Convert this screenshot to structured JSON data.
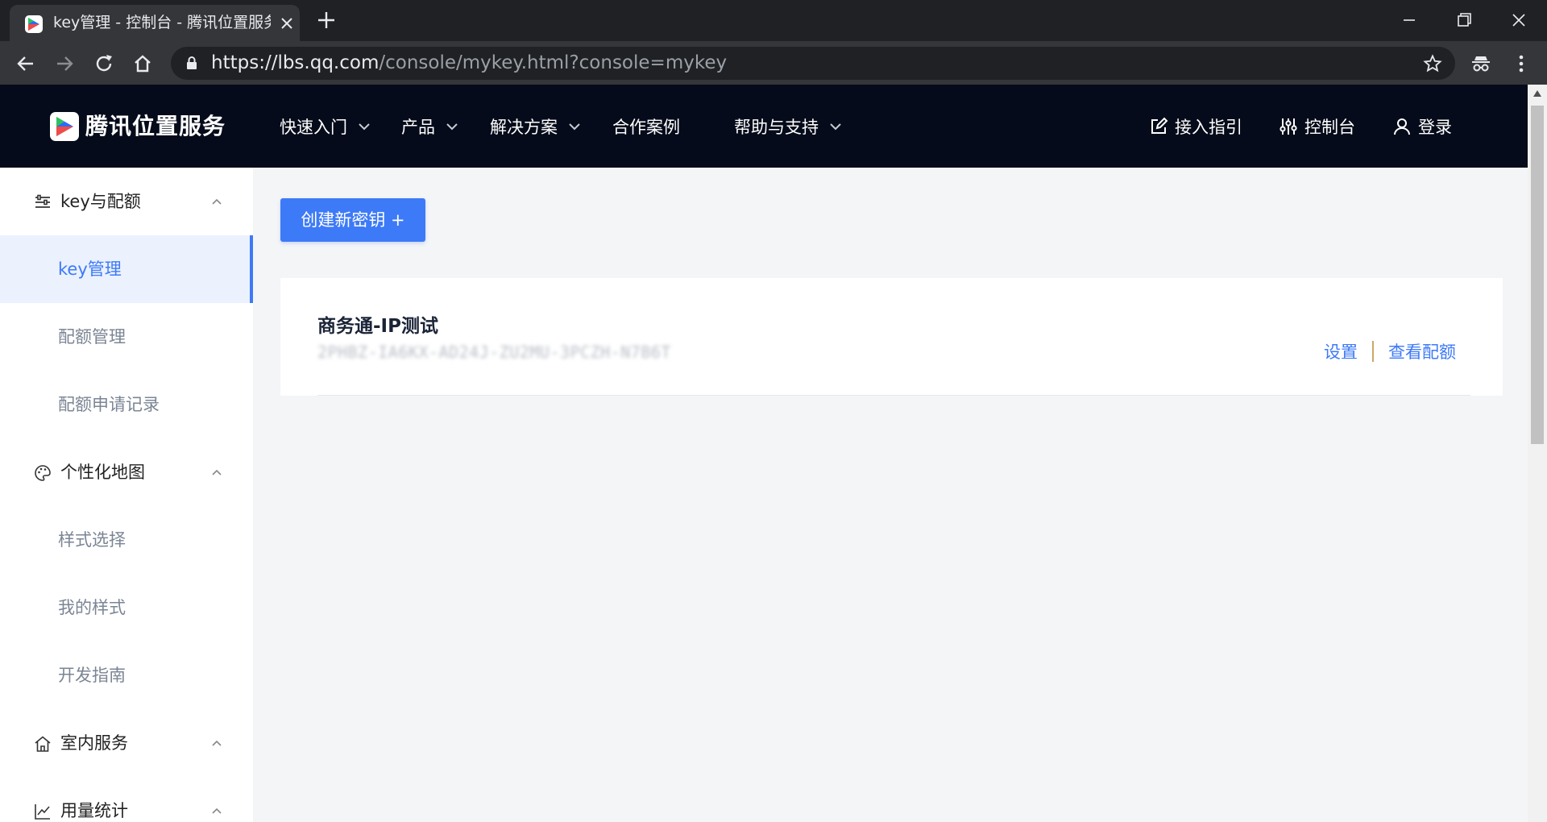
{
  "browser": {
    "tab_title": "key管理 - 控制台 - 腾讯位置服务",
    "url_host": "https://lbs.qq.com",
    "url_path": "/console/mykey.html?console=mykey"
  },
  "header": {
    "logo_text": "腾讯位置服务",
    "nav": [
      {
        "label": "快速入门"
      },
      {
        "label": "产品"
      },
      {
        "label": "解决方案"
      },
      {
        "label": "合作案例"
      },
      {
        "label": "帮助与支持"
      }
    ],
    "right": {
      "guide": "接入指引",
      "console": "控制台",
      "login": "登录"
    }
  },
  "sidebar": {
    "group_key": "key与配额",
    "item_key_manage": "key管理",
    "item_quota_manage": "配额管理",
    "item_quota_apply": "配额申请记录",
    "group_map": "个性化地图",
    "item_style_select": "样式选择",
    "item_my_style": "我的样式",
    "item_dev_guide": "开发指南",
    "group_indoor": "室内服务",
    "group_usage": "用量统计"
  },
  "main": {
    "create_button": "创建新密钥 +",
    "key_card": {
      "name": "商务通-IP测试",
      "key_value": "2PHBZ-IA6KX-AD24J-ZU2MU-3PCZH-N7B6T",
      "action_settings": "设置",
      "action_quota": "查看配额"
    }
  },
  "colors": {
    "accent": "#3d7af7",
    "header_bg": "#050b1a",
    "sidebar_active_bg": "#ebf1fd",
    "separator": "#c9a868"
  }
}
